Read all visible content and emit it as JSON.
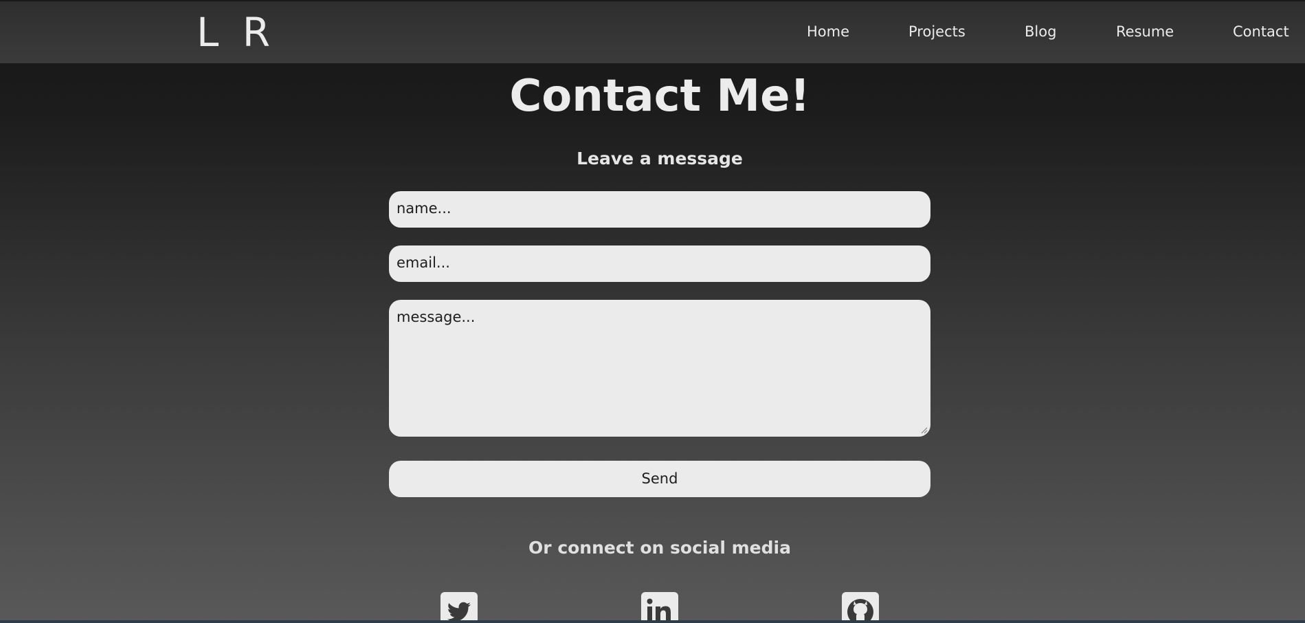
{
  "logo": "L R",
  "nav": {
    "home": "Home",
    "projects": "Projects",
    "blog": "Blog",
    "resume": "Resume",
    "contact": "Contact"
  },
  "page": {
    "title": "Contact Me!",
    "subtitle": "Leave a message"
  },
  "form": {
    "name_placeholder": "name...",
    "email_placeholder": "email...",
    "message_placeholder": "message...",
    "send_label": "Send"
  },
  "social": {
    "heading": "Or connect on social media",
    "icons": [
      "twitter-icon",
      "linkedin-icon",
      "github-icon"
    ]
  },
  "colors": {
    "text": "#ececec",
    "field_bg": "#ebebeb",
    "header_bg": "#363636"
  }
}
